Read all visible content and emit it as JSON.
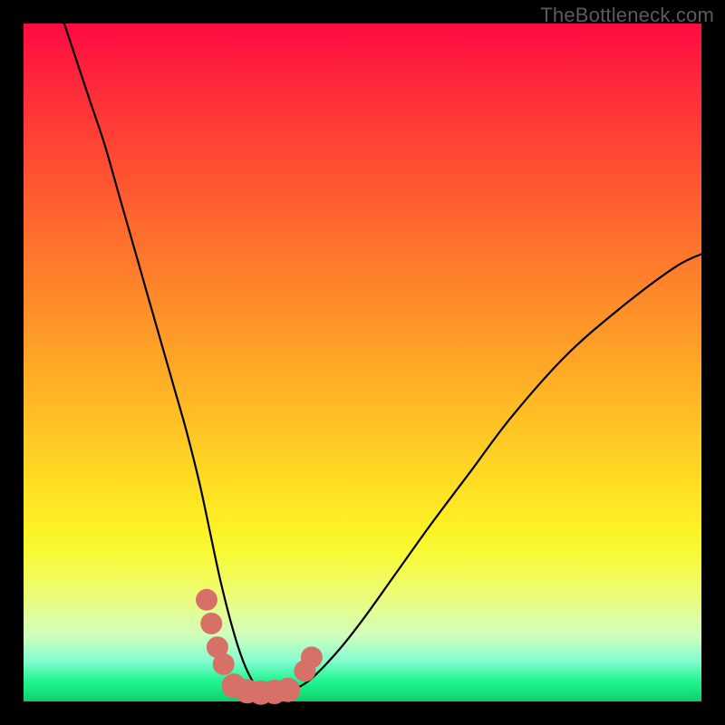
{
  "watermark": "TheBottleneck.com",
  "colors": {
    "frame": "#000000",
    "gradient_top": "#ff0b43",
    "gradient_mid": "#ffd823",
    "gradient_bottom": "#0fcb6d",
    "curve": "#000000",
    "marker": "#d77168"
  },
  "chart_data": {
    "type": "line",
    "title": "",
    "xlabel": "",
    "ylabel": "",
    "xlim": [
      0,
      100
    ],
    "ylim": [
      0,
      100
    ],
    "annotations": [
      "TheBottleneck.com"
    ],
    "series": [
      {
        "name": "bottleneck-curve",
        "x": [
          6,
          8,
          10,
          12,
          14,
          16,
          18,
          20,
          22,
          24,
          26,
          27.5,
          29,
          30.5,
          32,
          33.5,
          35,
          37,
          39,
          42,
          46,
          50,
          55,
          60,
          66,
          72,
          80,
          88,
          96,
          100
        ],
        "y": [
          100,
          94,
          88,
          82,
          75,
          68,
          61,
          54,
          47,
          40,
          32,
          25,
          18,
          12,
          7,
          3.5,
          1.5,
          1.2,
          1.5,
          3,
          7,
          12,
          19,
          26,
          34,
          42,
          51,
          58,
          64,
          66
        ]
      }
    ],
    "markers": [
      {
        "x": 27.0,
        "y": 15.0,
        "r": 1.6
      },
      {
        "x": 27.7,
        "y": 11.5,
        "r": 1.6
      },
      {
        "x": 28.6,
        "y": 8.0,
        "r": 1.6
      },
      {
        "x": 29.5,
        "y": 5.5,
        "r": 1.6
      },
      {
        "x": 31.0,
        "y": 2.3,
        "r": 1.8
      },
      {
        "x": 33.0,
        "y": 1.5,
        "r": 1.8
      },
      {
        "x": 35.0,
        "y": 1.3,
        "r": 1.8
      },
      {
        "x": 37.0,
        "y": 1.4,
        "r": 1.8
      },
      {
        "x": 39.0,
        "y": 1.7,
        "r": 1.8
      },
      {
        "x": 41.5,
        "y": 4.5,
        "r": 1.6
      },
      {
        "x": 42.5,
        "y": 6.5,
        "r": 1.6
      }
    ]
  }
}
